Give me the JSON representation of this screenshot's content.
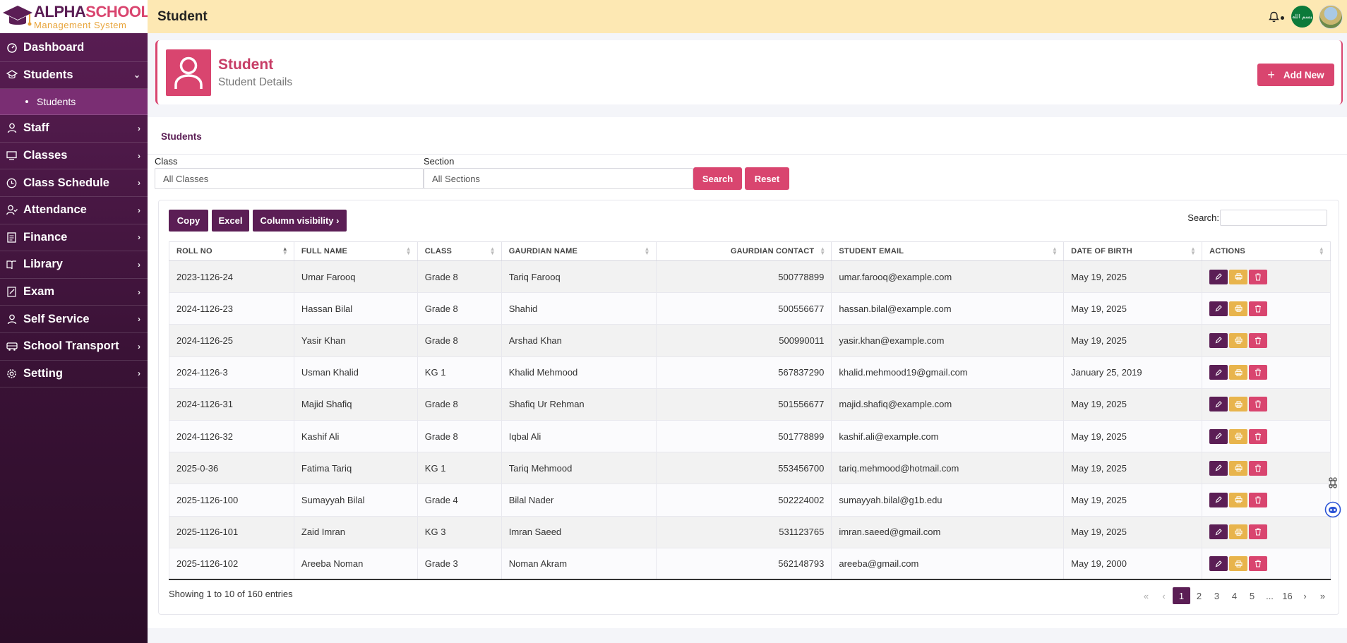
{
  "app": {
    "logo_word1": "ALPHA",
    "logo_word2": "SCHOOL",
    "logo_sub": "Management System",
    "page_title": "Student"
  },
  "topbar": {
    "flag_text": "بسم الله"
  },
  "sidebar": {
    "items": [
      {
        "label": "Dashboard",
        "icon": "dashboard-icon"
      },
      {
        "label": "Students",
        "icon": "graduation-cap-icon",
        "expanded": true
      },
      {
        "label": "Staff",
        "icon": "user-icon"
      },
      {
        "label": "Classes",
        "icon": "monitor-icon"
      },
      {
        "label": "Class Schedule",
        "icon": "clock-icon"
      },
      {
        "label": "Attendance",
        "icon": "user-check-icon"
      },
      {
        "label": "Finance",
        "icon": "document-icon"
      },
      {
        "label": "Library",
        "icon": "book-icon"
      },
      {
        "label": "Exam",
        "icon": "edit-icon"
      },
      {
        "label": "Self Service",
        "icon": "user-icon"
      },
      {
        "label": "School Transport",
        "icon": "bus-icon"
      },
      {
        "label": "Setting",
        "icon": "gear-icon"
      }
    ],
    "sub_item": "Students",
    "chevron_down": "⌄",
    "chevron_right": "›"
  },
  "header": {
    "title": "Student",
    "subtitle": "Student Details",
    "add_label": "Add New"
  },
  "panel": {
    "title": "Students",
    "class_label": "Class",
    "class_value": "All Classes",
    "section_label": "Section",
    "section_value": "All Sections",
    "search_btn": "Search",
    "reset_btn": "Reset"
  },
  "table": {
    "copy_btn": "Copy",
    "excel_btn": "Excel",
    "colvis_btn": "Column visibility ›",
    "search_label": "Search:",
    "columns": [
      "Roll No",
      "Full Name",
      "Class",
      "Gaurdian Name",
      "Gaurdian Contact",
      "Student Email",
      "Date of Birth",
      "Actions"
    ],
    "rows": [
      {
        "roll": "2023-1126-24",
        "name": "Umar Farooq",
        "class": "Grade 8",
        "guardian": "Tariq Farooq",
        "contact": "500778899",
        "email": "umar.farooq@example.com",
        "dob": "May 19, 2025"
      },
      {
        "roll": "2024-1126-23",
        "name": "Hassan Bilal",
        "class": "Grade 8",
        "guardian": "Shahid",
        "contact": "500556677",
        "email": "hassan.bilal@example.com",
        "dob": "May 19, 2025"
      },
      {
        "roll": "2024-1126-25",
        "name": "Yasir Khan",
        "class": "Grade 8",
        "guardian": "Arshad Khan",
        "contact": "500990011",
        "email": "yasir.khan@example.com",
        "dob": "May 19, 2025"
      },
      {
        "roll": "2024-1126-3",
        "name": "Usman Khalid",
        "class": "KG 1",
        "guardian": "Khalid Mehmood",
        "contact": "567837290",
        "email": "khalid.mehmood19@gmail.com",
        "dob": "January 25, 2019"
      },
      {
        "roll": "2024-1126-31",
        "name": "Majid Shafiq",
        "class": "Grade 8",
        "guardian": "Shafiq Ur Rehman",
        "contact": "501556677",
        "email": "majid.shafiq@example.com",
        "dob": "May 19, 2025"
      },
      {
        "roll": "2024-1126-32",
        "name": "Kashif Ali",
        "class": "Grade 8",
        "guardian": "Iqbal Ali",
        "contact": "501778899",
        "email": "kashif.ali@example.com",
        "dob": "May 19, 2025"
      },
      {
        "roll": "2025-0-36",
        "name": "Fatima Tariq",
        "class": "KG 1",
        "guardian": "Tariq Mehmood",
        "contact": "553456700",
        "email": "tariq.mehmood@hotmail.com",
        "dob": "May 19, 2025"
      },
      {
        "roll": "2025-1126-100",
        "name": "Sumayyah Bilal",
        "class": "Grade 4",
        "guardian": "Bilal Nader",
        "contact": "502224002",
        "email": "sumayyah.bilal@g1b.edu",
        "dob": "May 19, 2025"
      },
      {
        "roll": "2025-1126-101",
        "name": "Zaid Imran",
        "class": "KG 3",
        "guardian": "Imran Saeed",
        "contact": "531123765",
        "email": "imran.saeed@gmail.com",
        "dob": "May 19, 2025"
      },
      {
        "roll": "2025-1126-102",
        "name": "Areeba Noman",
        "class": "Grade 3",
        "guardian": "Noman Akram",
        "contact": "562148793",
        "email": "areeba@gmail.com",
        "dob": "May 19, 2000"
      }
    ],
    "info": "Showing 1 to 10 of 160 entries",
    "pagination": [
      "«",
      "‹",
      "1",
      "2",
      "3",
      "4",
      "5",
      "...",
      "16",
      "›",
      "»"
    ],
    "active_page": "1"
  },
  "colors": {
    "primary": "#5b1e55",
    "accent": "#d9456f",
    "warning": "#e8b44c",
    "topbar": "#fde8b3"
  }
}
